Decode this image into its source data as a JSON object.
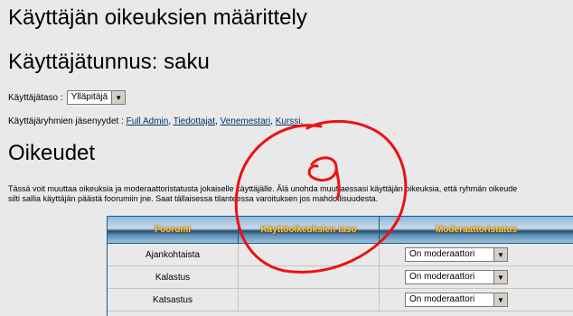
{
  "page": {
    "title": "Käyttäjän oikeuksien määrittely",
    "username_heading": "Käyttäjätunnus: saku"
  },
  "user_level": {
    "label": "Käyttäjätaso :",
    "selected": "Ylläpitäjä"
  },
  "groups": {
    "label": "Käyttäjäryhmien jäsenyydet :",
    "items": [
      "Full Admin",
      "Tiedottajat",
      "Venemestari",
      "Kurssi"
    ]
  },
  "permissions": {
    "heading": "Oikeudet",
    "intro_line1": "Tässä voit muuttaa oikeuksia ja moderaattoristatusta jokaiselle käyttäjälle. Älä unohda muuttaessasi käyttäjän oikeuksia, että ryhmän oikeude",
    "intro_line2": "silti sallia käyttäjän päästä foorumiin jne. Saat tällaisessa tilanteessa varoituksen jos mahdollisuudesta.",
    "columns": [
      "Foorumi",
      "Käyttöoikeuksien taso",
      "Moderaattoristatus"
    ],
    "rows": [
      {
        "forum": "Ajankohtaista",
        "mod": "On moderaattori"
      },
      {
        "forum": "Kalastus",
        "mod": "On moderaattori"
      },
      {
        "forum": "Katsastus",
        "mod": "On moderaattori"
      }
    ]
  },
  "colors": {
    "background": "#e9e9e9",
    "table_border": "#1a5c8a",
    "header_text": "#ffcc33",
    "annotation": "#ee1111"
  }
}
